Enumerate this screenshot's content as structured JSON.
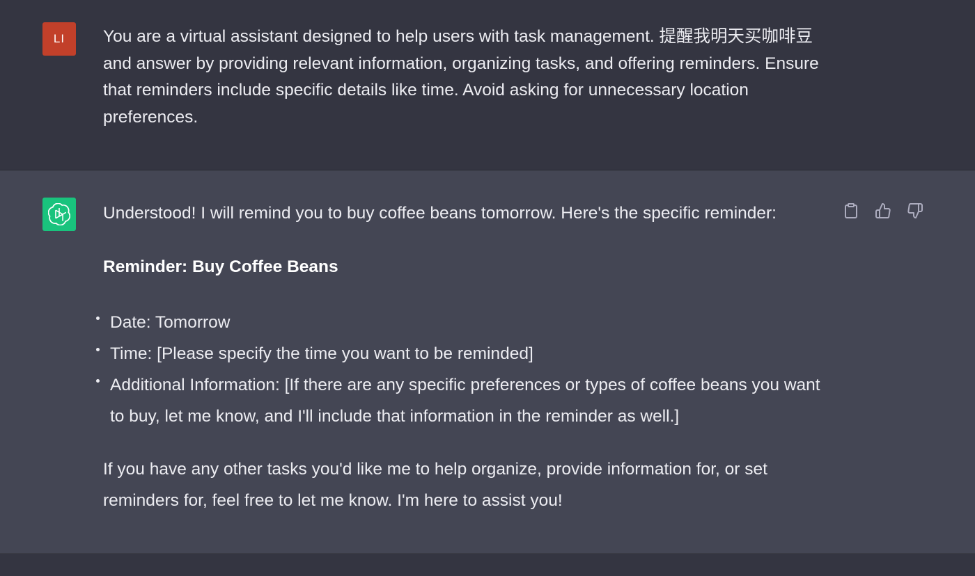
{
  "user_message": {
    "avatar_initials": "LI",
    "avatar_color": "#c2402a",
    "text": "You are a virtual assistant designed to help users with task management. 提醒我明天买咖啡豆 and answer by providing relevant information, organizing tasks, and offering reminders. Ensure that reminders include specific details like time. Avoid asking for unnecessary location preferences."
  },
  "assistant_message": {
    "avatar_icon": "openai-logo-icon",
    "avatar_color": "#19c37d",
    "intro": "Understood! I will remind you to buy coffee beans tomorrow. Here's the specific reminder:",
    "heading": "Reminder: Buy Coffee Beans",
    "bullets": [
      "Date: Tomorrow",
      "Time: [Please specify the time you want to be reminded]",
      "Additional Information: [If there are any specific preferences or types of coffee beans you want to buy, let me know, and I'll include that information in the reminder as well.]"
    ],
    "closing": "If you have any other tasks you'd like me to help organize, provide information for, or set reminders for, feel free to let me know. I'm here to assist you!"
  },
  "actions": {
    "copy_icon": "clipboard-icon",
    "like_icon": "thumbs-up-icon",
    "dislike_icon": "thumbs-down-icon"
  },
  "colors": {
    "user_bg": "#343541",
    "assistant_bg": "#444654",
    "text": "#ececf1",
    "icon": "#acacbe"
  }
}
